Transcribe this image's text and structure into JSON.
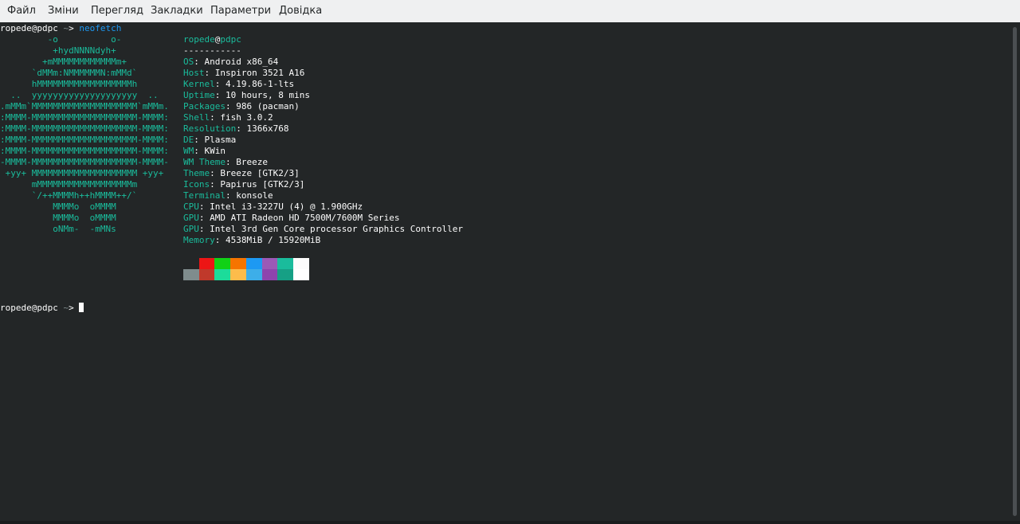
{
  "menubar": {
    "items": [
      "Файл",
      "Зміни",
      "Перегляд",
      "Закладки",
      "Параметри",
      "Довідка"
    ]
  },
  "terminal": {
    "prompt_user_host": "ropede@pdpc",
    "prompt_tilde": "~",
    "prompt_arrow": ">",
    "command": "neofetch",
    "ascii_logo": [
      "         -o          o-",
      "          +hydNNNNdyh+",
      "        +mMMMMMMMMMMMMm+",
      "      `dMMm:NMMMMMMN:mMMd`",
      "      hMMMMMMMMMMMMMMMMMMh",
      "  ..  yyyyyyyyyyyyyyyyyyyy  ..",
      ".mMMm`MMMMMMMMMMMMMMMMMMMM`mMMm.",
      ":MMMM-MMMMMMMMMMMMMMMMMMMM-MMMM:",
      ":MMMM-MMMMMMMMMMMMMMMMMMMM-MMMM:",
      ":MMMM-MMMMMMMMMMMMMMMMMMMM-MMMM:",
      ":MMMM-MMMMMMMMMMMMMMMMMMMM-MMMM:",
      "-MMMM-MMMMMMMMMMMMMMMMMMMM-MMMM-",
      " +yy+ MMMMMMMMMMMMMMMMMMMM +yy+",
      "      mMMMMMMMMMMMMMMMMMMm",
      "      `/++MMMMh++hMMMM++/`",
      "          MMMMo  oMMMM",
      "          MMMMo  oMMMM",
      "          oNMm-  -mMNs"
    ],
    "info_user": "ropede",
    "info_at": "@",
    "info_host": "pdpc",
    "separator": "-----------",
    "info": [
      {
        "key": "OS",
        "value": "Android x86_64"
      },
      {
        "key": "Host",
        "value": "Inspiron 3521 A16"
      },
      {
        "key": "Kernel",
        "value": "4.19.86-1-lts"
      },
      {
        "key": "Uptime",
        "value": "10 hours, 8 mins"
      },
      {
        "key": "Packages",
        "value": "986 (pacman)"
      },
      {
        "key": "Shell",
        "value": "fish 3.0.2"
      },
      {
        "key": "Resolution",
        "value": "1366x768"
      },
      {
        "key": "DE",
        "value": "Plasma"
      },
      {
        "key": "WM",
        "value": "KWin"
      },
      {
        "key": "WM Theme",
        "value": "Breeze"
      },
      {
        "key": "Theme",
        "value": "Breeze [GTK2/3]"
      },
      {
        "key": "Icons",
        "value": "Papirus [GTK2/3]"
      },
      {
        "key": "Terminal",
        "value": "konsole"
      },
      {
        "key": "CPU",
        "value": "Intel i3-3227U (4) @ 1.900GHz"
      },
      {
        "key": "GPU",
        "value": "AMD ATI Radeon HD 7500M/7600M Series"
      },
      {
        "key": "GPU",
        "value": "Intel 3rd Gen Core processor Graphics Controller"
      },
      {
        "key": "Memory",
        "value": "4538MiB / 15920MiB"
      }
    ],
    "palette_top": [
      "#232627",
      "#ed1515",
      "#11d116",
      "#f67400",
      "#1d99f3",
      "#9b59b6",
      "#1abc9c",
      "#fcfcfc"
    ],
    "palette_bottom": [
      "#7f8c8d",
      "#c0392b",
      "#1cdc9a",
      "#fdbc4b",
      "#3daee9",
      "#8e44ad",
      "#16a085",
      "#ffffff"
    ]
  },
  "colors": {
    "background": "#232627",
    "accent": "#1abc9c",
    "command": "#1d99f3",
    "text": "#fcfcfc"
  }
}
